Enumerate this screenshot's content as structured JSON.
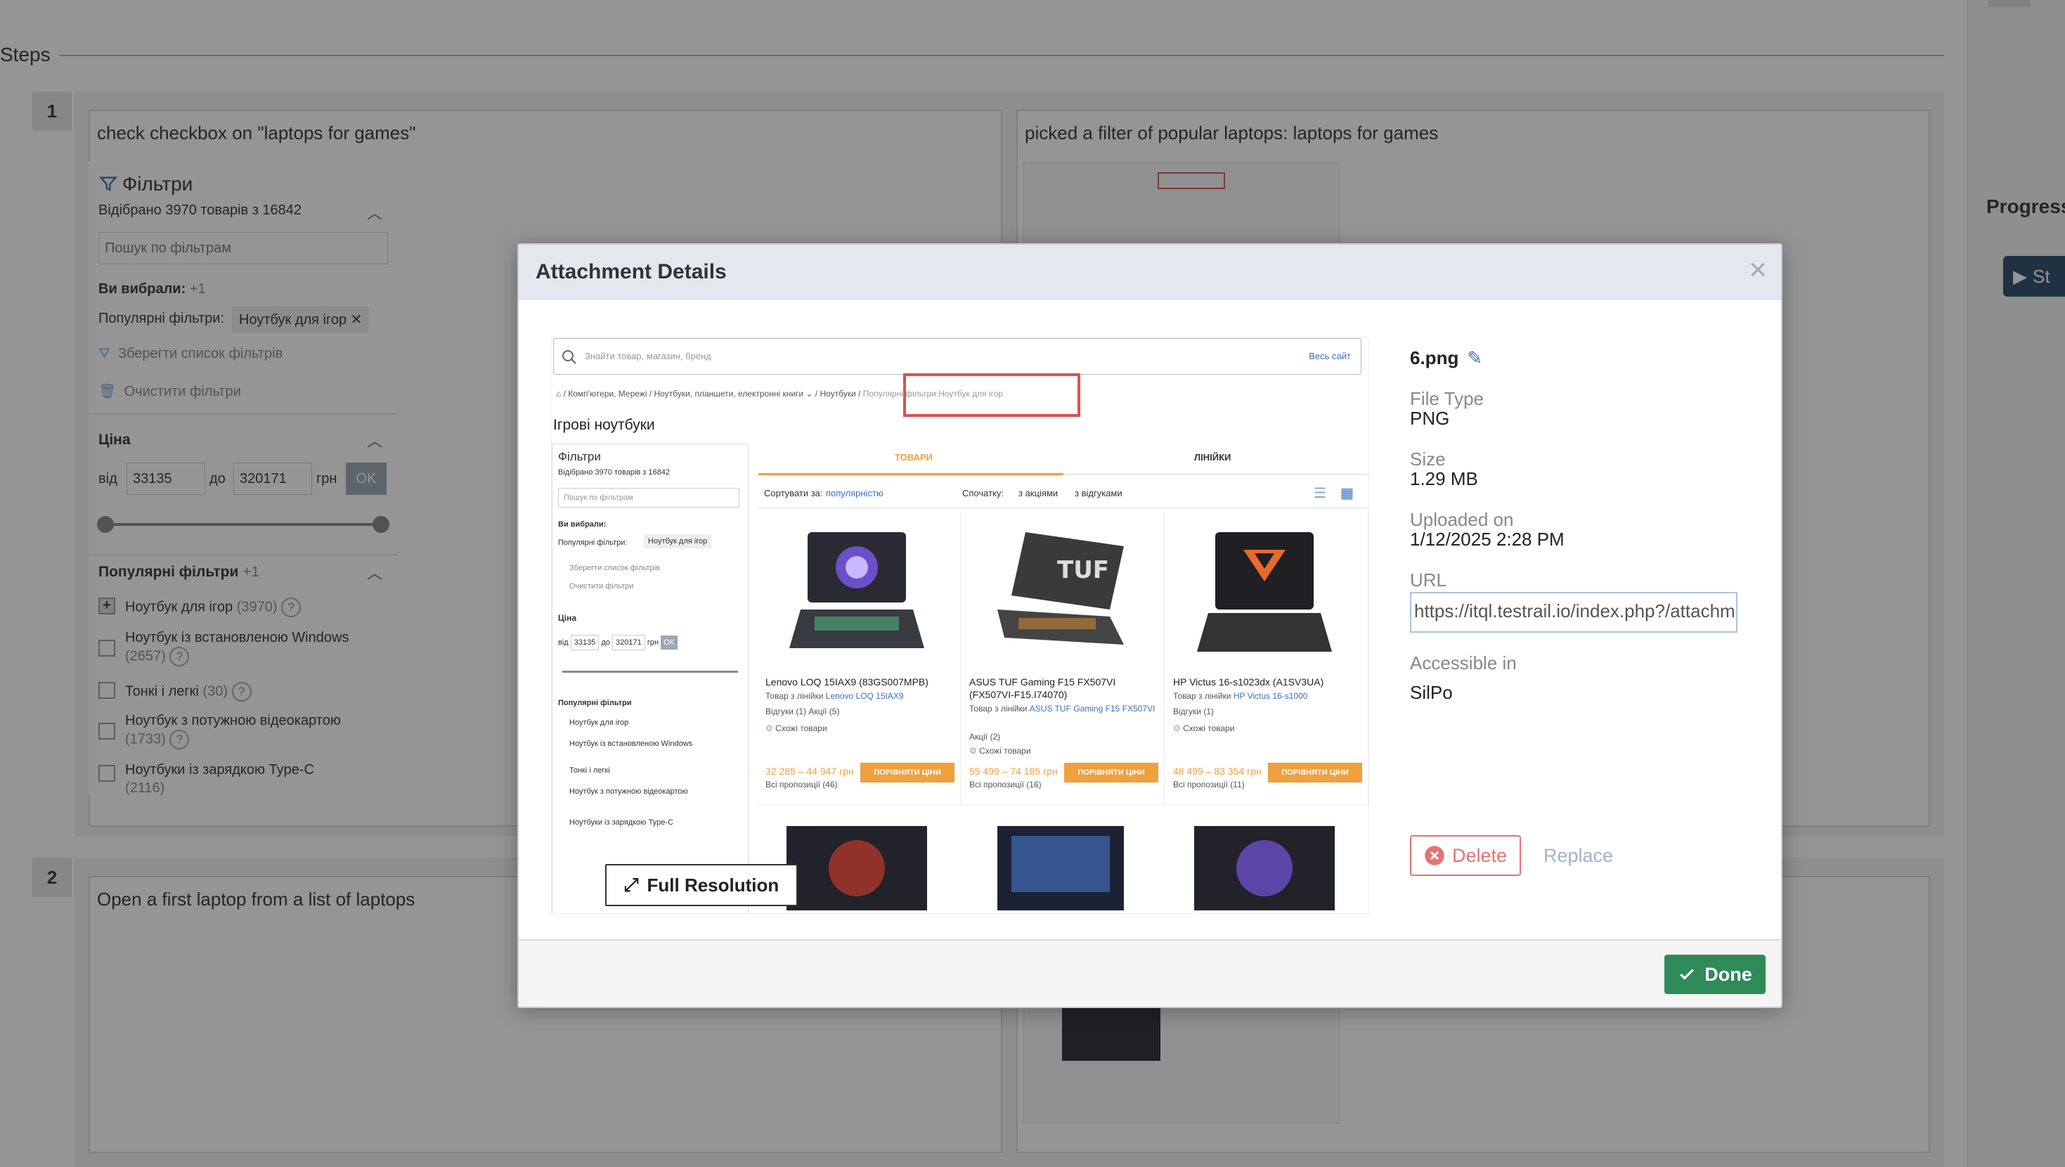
{
  "background": {
    "steps_title": "Steps",
    "progress_label": "Progress",
    "side_button_label": "St",
    "steps": [
      {
        "number": "1",
        "expected": "check checkbox on \"laptops for games\"",
        "actual": "picked a filter of popular laptops: laptops for games"
      },
      {
        "number": "2",
        "expected": "Open a first laptop from a list of laptops"
      }
    ],
    "filters_panel": {
      "title": "Фільтри",
      "count": "Відібрано 3970 товарів з 16842",
      "search_placeholder": "Пошук по фільтрам",
      "selected_label": "Ви вибрали:",
      "selected_count": "+1",
      "popular_label": "Популярні фільтри:",
      "popular_chip": "Ноутбук для ігор",
      "save_filters": "Зберегти список фільтрів",
      "clear_filters": "Очистити фільтри",
      "price_title": "Ціна",
      "price_from_label": "від",
      "price_from": "33135",
      "price_to_label": "до",
      "price_to": "320171",
      "currency": "грн",
      "ok": "OK",
      "popular_section": "Популярні фільтри",
      "popular_section_count": "+1",
      "options": [
        {
          "label": "Ноутбук для ігор",
          "count": "(3970)"
        },
        {
          "label": "Ноутбук із встановленою Windows",
          "count": "(2657)"
        },
        {
          "label": "Тонкі і легкі",
          "count": "(30)"
        },
        {
          "label": "Ноутбук з потужною відеокартою",
          "count": "(1733)"
        },
        {
          "label": "Ноутбуки із зарядкою Type-C",
          "count": "(2116)"
        }
      ]
    }
  },
  "modal": {
    "title": "Attachment Details",
    "close_symbol": "×",
    "full_resolution": "Full Resolution",
    "done": "Done",
    "details": {
      "file_name": "6.png",
      "file_type_label": "File Type",
      "file_type": "PNG",
      "size_label": "Size",
      "size": "1.29 MB",
      "uploaded_label": "Uploaded on",
      "uploaded": "1/12/2025 2:28 PM",
      "url_label": "URL",
      "url": "https://itql.testrail.io/index.php?/attachments/get/",
      "accessible_label": "Accessible in",
      "accessible": "SilPo",
      "delete": "Delete",
      "replace": "Replace"
    },
    "preview": {
      "search_placeholder": "Знайти товар, магазин, бренд",
      "search_scope": "Весь сайт",
      "breadcrumbs": [
        "Комп'ютери, Мережі",
        "Ноутбуки, планшети, електронні книги",
        "Ноутбуки",
        "Популярні фільтри:Ноутбук для ігор"
      ],
      "heading": "Ігрові ноутбуки",
      "tab_products": "ТОВАРИ",
      "tab_lines": "ЛІНІЙКИ",
      "sort_label": "Сортувати за:",
      "sort_value": "популярністю",
      "first_label": "Спочатку:",
      "with_promos": "з акціями",
      "with_reviews": "з відгуками",
      "compare_label": "ПОРІВНЯТИ ЦІНИ",
      "similar_label": "Схожі товари",
      "products": [
        {
          "name": "Lenovo LOQ 15IAX9 (83GS007MPB)",
          "series_prefix": "Товар з лінійки",
          "series": "Lenovo LOQ 15IAX9",
          "meta": "Відгуки (1)   Акції (5)",
          "price": "32 285 – 44 947 грн",
          "offers": "Всі пропозиції (46)"
        },
        {
          "name": "ASUS TUF Gaming F15 FX507VI (FX507VI-F15.I74070)",
          "series_prefix": "Товар з лінійки",
          "series": "ASUS TUF Gaming F15 FX507VI",
          "meta": "Акції (2)",
          "price": "55 499 – 74 185 грн",
          "offers": "Всі пропозиції (16)"
        },
        {
          "name": "HP Victus 16-s1023dx (A1SV3UA)",
          "series_prefix": "Товар з лінійки",
          "series": "HP Victus 16-s1000",
          "meta": "Відгуки (1)",
          "price": "48 499 – 83 354 грн",
          "offers": "Всі пропозиції (11)"
        }
      ]
    }
  },
  "colors": {
    "accent_orange": "#f0a03c",
    "done_green": "#2e8b57",
    "delete_red": "#e57373",
    "highlight_red": "#d9534f",
    "side_button": "#2a4a6b"
  }
}
